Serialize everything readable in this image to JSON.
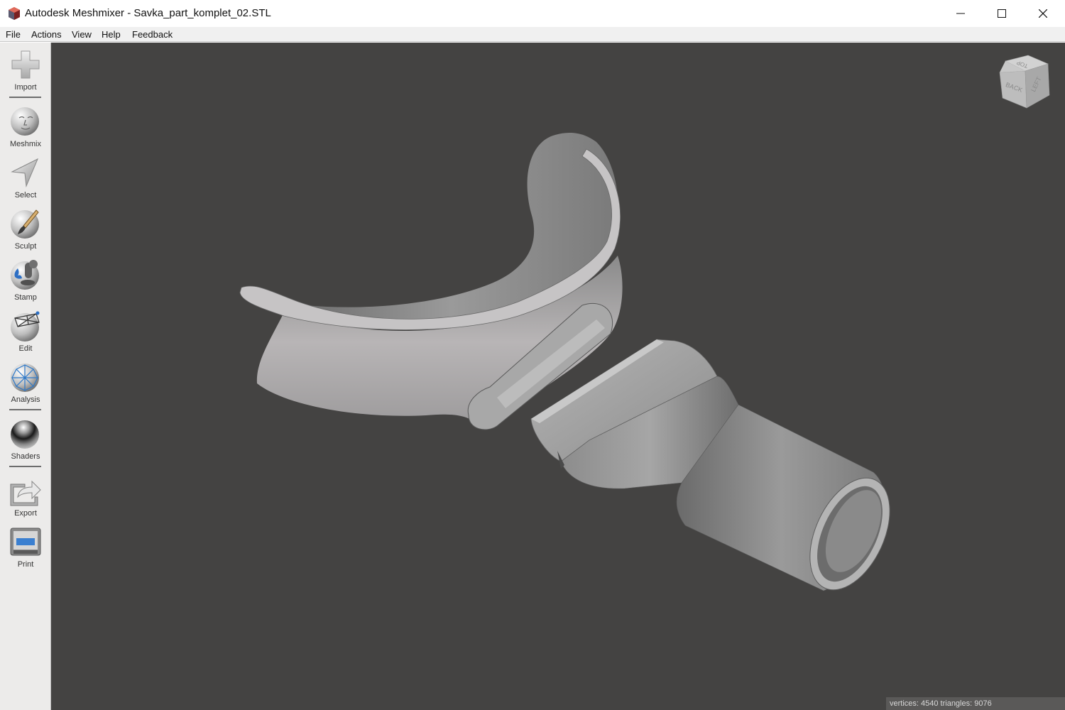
{
  "window": {
    "title": "Autodesk Meshmixer - Savka_part_komplet_02.STL",
    "app_icon": "meshmixer-logo-icon",
    "controls": [
      "minimize-icon",
      "maximize-icon",
      "close-icon"
    ]
  },
  "menu": {
    "items": [
      {
        "label": "File"
      },
      {
        "label": "Actions"
      },
      {
        "label": "View"
      },
      {
        "label": "Help"
      },
      {
        "label": "Feedback"
      }
    ]
  },
  "toolbar": {
    "tools": [
      {
        "label": "Import",
        "icon": "plus-icon"
      },
      {
        "label": "Meshmix",
        "icon": "face-sphere-icon"
      },
      {
        "label": "Select",
        "icon": "arrow-cursor-icon"
      },
      {
        "label": "Sculpt",
        "icon": "brush-sphere-icon"
      },
      {
        "label": "Stamp",
        "icon": "stamp-sphere-icon"
      },
      {
        "label": "Edit",
        "icon": "wireframe-sphere-icon"
      },
      {
        "label": "Analysis",
        "icon": "network-sphere-icon"
      },
      {
        "label": "Shaders",
        "icon": "chrome-sphere-icon"
      },
      {
        "label": "Export",
        "icon": "export-arrow-icon"
      },
      {
        "label": "Print",
        "icon": "printer-icon"
      }
    ]
  },
  "navcube": {
    "faces": [
      "TOP",
      "BACK",
      "LEFT"
    ]
  },
  "status": {
    "text": "vertices: 4540 triangles: 9076"
  },
  "colors": {
    "viewport_bg": "#444342",
    "toolbar_bg": "#ecebea",
    "model": "#9a9a9a"
  }
}
